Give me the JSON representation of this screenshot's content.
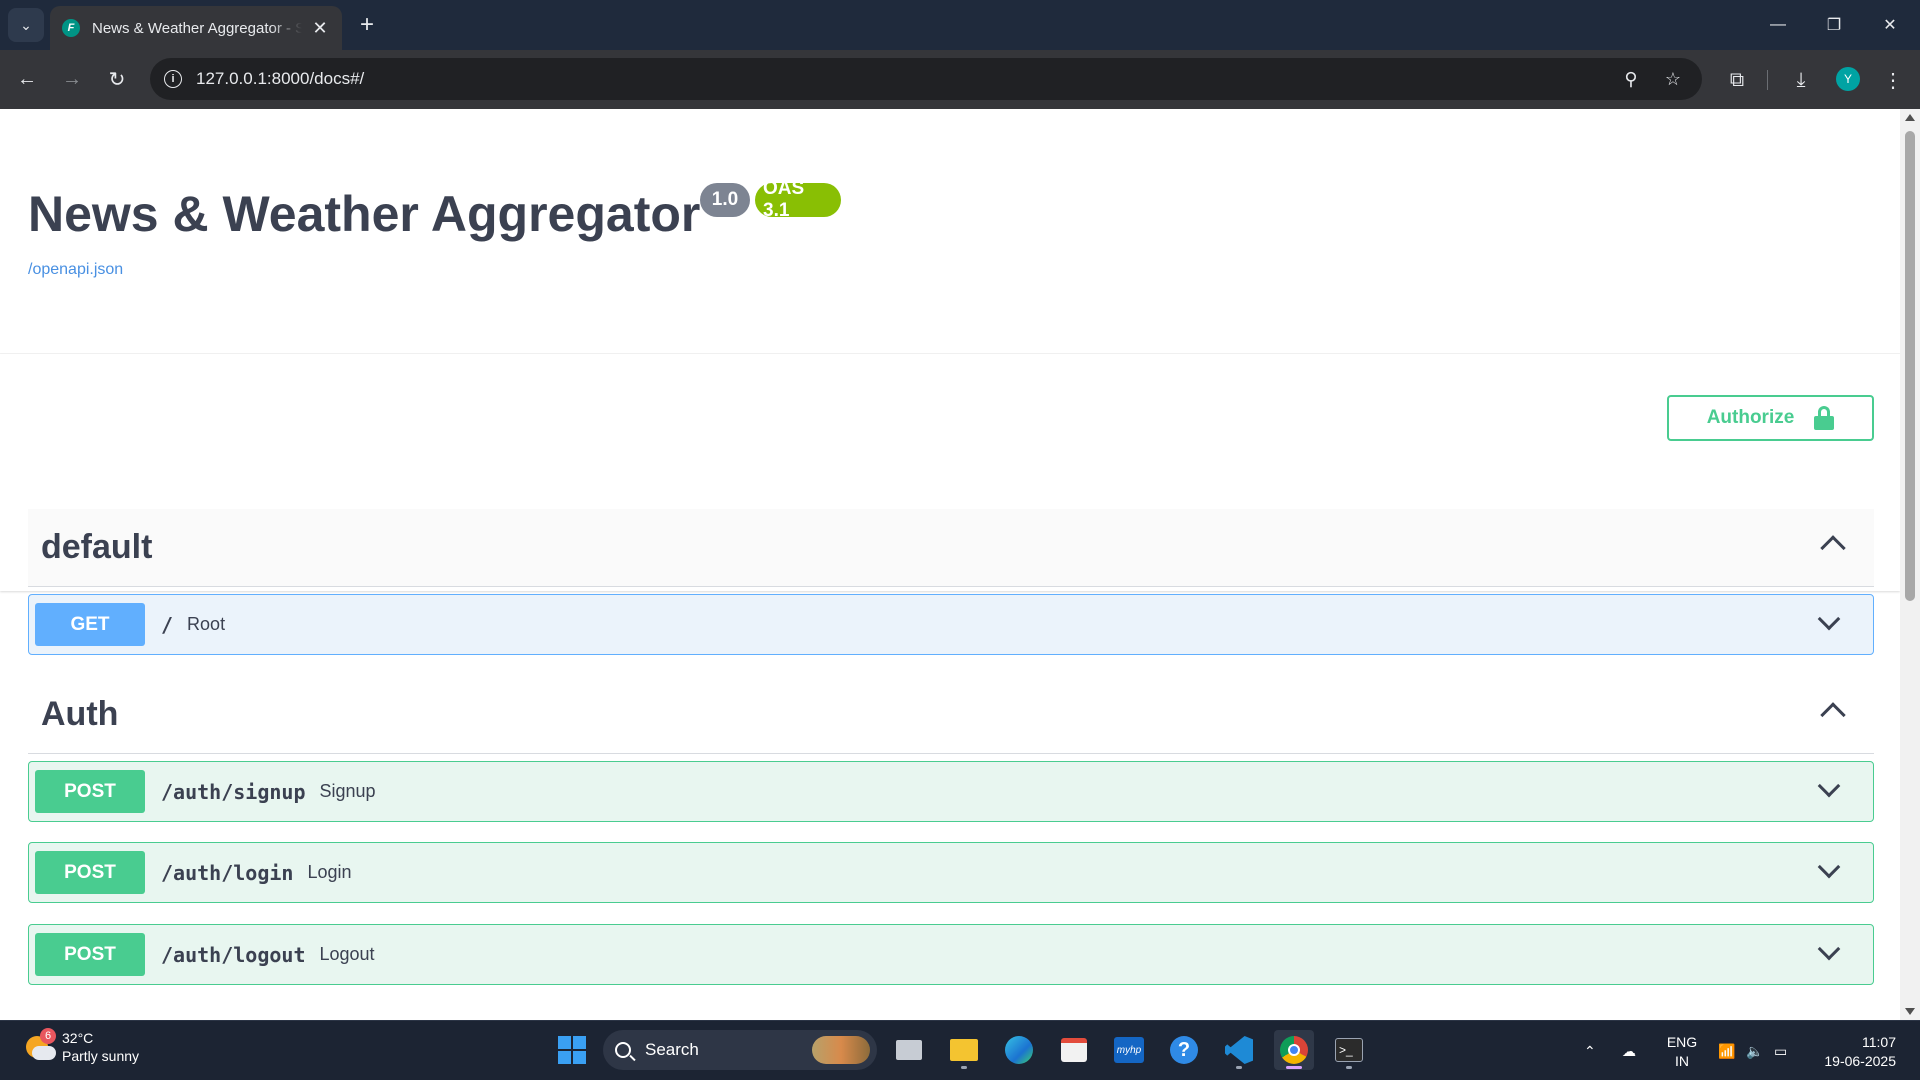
{
  "browser": {
    "tab_title": "News & Weather Aggregator - Swagger UI",
    "favicon_letter": "F",
    "url": "127.0.0.1:8000/docs#/",
    "profile_initial": "Y"
  },
  "page": {
    "title": "News & Weather Aggregator",
    "version_badge": "1.0",
    "oas_badge": "OAS 3.1",
    "spec_link": "/openapi.json",
    "authorize_label": "Authorize"
  },
  "sections": [
    {
      "name": "default",
      "operations": [
        {
          "method": "GET",
          "path": "/",
          "summary": "Root"
        }
      ]
    },
    {
      "name": "Auth",
      "operations": [
        {
          "method": "POST",
          "path": "/auth/signup",
          "summary": "Signup"
        },
        {
          "method": "POST",
          "path": "/auth/login",
          "summary": "Login"
        },
        {
          "method": "POST",
          "path": "/auth/logout",
          "summary": "Logout"
        }
      ]
    }
  ],
  "colors": {
    "get": "#61affe",
    "post": "#49cc90",
    "oas_badge": "#89bf04",
    "version_badge": "#7d8492",
    "title_text": "#3b4151"
  },
  "taskbar": {
    "weather_temp": "32°C",
    "weather_desc": "Partly sunny",
    "weather_alert_count": "6",
    "search_label": "Search",
    "lang_top": "ENG",
    "lang_bottom": "IN",
    "time": "11:07",
    "date": "19-06-2025"
  }
}
